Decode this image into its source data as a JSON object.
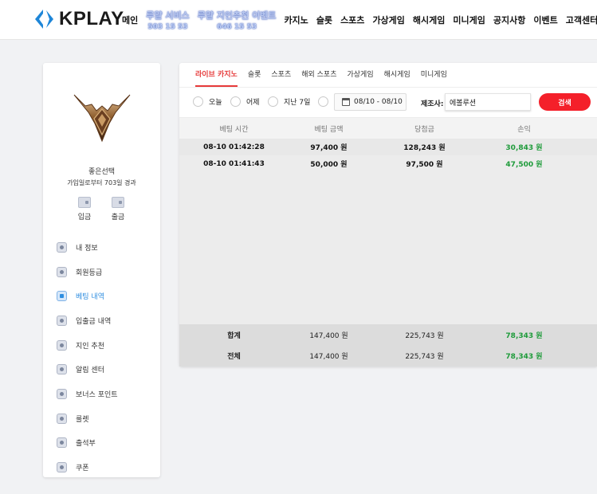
{
  "header": {
    "logo_text": "KPLAY",
    "nav": [
      {
        "label": "메인"
      },
      {
        "label": "루얄 서비스",
        "sub": "503 15 53"
      },
      {
        "label": "루얄 지인추천 이벤트",
        "sub": "646 15 53"
      },
      {
        "label": "카지노"
      },
      {
        "label": "슬롯"
      },
      {
        "label": "스포츠"
      },
      {
        "label": "가상게임"
      },
      {
        "label": "해시게임"
      },
      {
        "label": "미니게임"
      },
      {
        "label": "공지사항"
      },
      {
        "label": "이벤트"
      },
      {
        "label": "고객센터"
      }
    ]
  },
  "sidebar": {
    "emblem": "winged-rank-emblem",
    "user_name": "좋은선택",
    "user_days": "가입일로부터 703일 경과",
    "deposit_label": "입금",
    "withdraw_label": "출금",
    "items": [
      {
        "label": "내 정보",
        "icon": "user-icon"
      },
      {
        "label": "회원등급",
        "icon": "grade-icon"
      },
      {
        "label": "베팅 내역",
        "icon": "betting-icon",
        "active": true
      },
      {
        "label": "입출금 내역",
        "icon": "wallet-icon"
      },
      {
        "label": "지인 추천",
        "icon": "referral-icon"
      },
      {
        "label": "알림 센터",
        "icon": "chat-icon"
      },
      {
        "label": "보너스 포인트",
        "icon": "points-icon"
      },
      {
        "label": "룰렛",
        "icon": "roulette-icon"
      },
      {
        "label": "출석부",
        "icon": "calendar-icon"
      },
      {
        "label": "쿠폰",
        "icon": "coupon-icon"
      }
    ]
  },
  "main": {
    "tabs": [
      {
        "label": "라이브 카지노",
        "active": true
      },
      {
        "label": "슬롯"
      },
      {
        "label": "스포츠"
      },
      {
        "label": "해외 스포츠"
      },
      {
        "label": "가상게임"
      },
      {
        "label": "해시게임"
      },
      {
        "label": "미니게임"
      }
    ],
    "filters": {
      "today": "오늘",
      "yesterday": "어제",
      "last7": "지난 7일",
      "date_range": "08/10 - 08/10",
      "provider_label": "제조사:",
      "provider_value": "에볼루션",
      "search_label": "검색"
    },
    "table": {
      "headers": [
        "베팅 시간",
        "베팅 금액",
        "당첨금",
        "손익"
      ],
      "rows": [
        [
          "08-10 01:42:28",
          "97,400 원",
          "128,243 원",
          "30,843 원"
        ],
        [
          "08-10 01:41:43",
          "50,000 원",
          "97,500 원",
          "47,500 원"
        ]
      ],
      "footer": [
        [
          "합계",
          "147,400 원",
          "225,743 원",
          "78,343 원"
        ],
        [
          "전체",
          "147,400 원",
          "225,743 원",
          "78,343 원"
        ]
      ]
    }
  },
  "colors": {
    "accent_red": "#f4202a",
    "active_blue": "#2f8ee0",
    "profit_green": "#1e9b3a",
    "logo_blue": "#1e86d8"
  }
}
